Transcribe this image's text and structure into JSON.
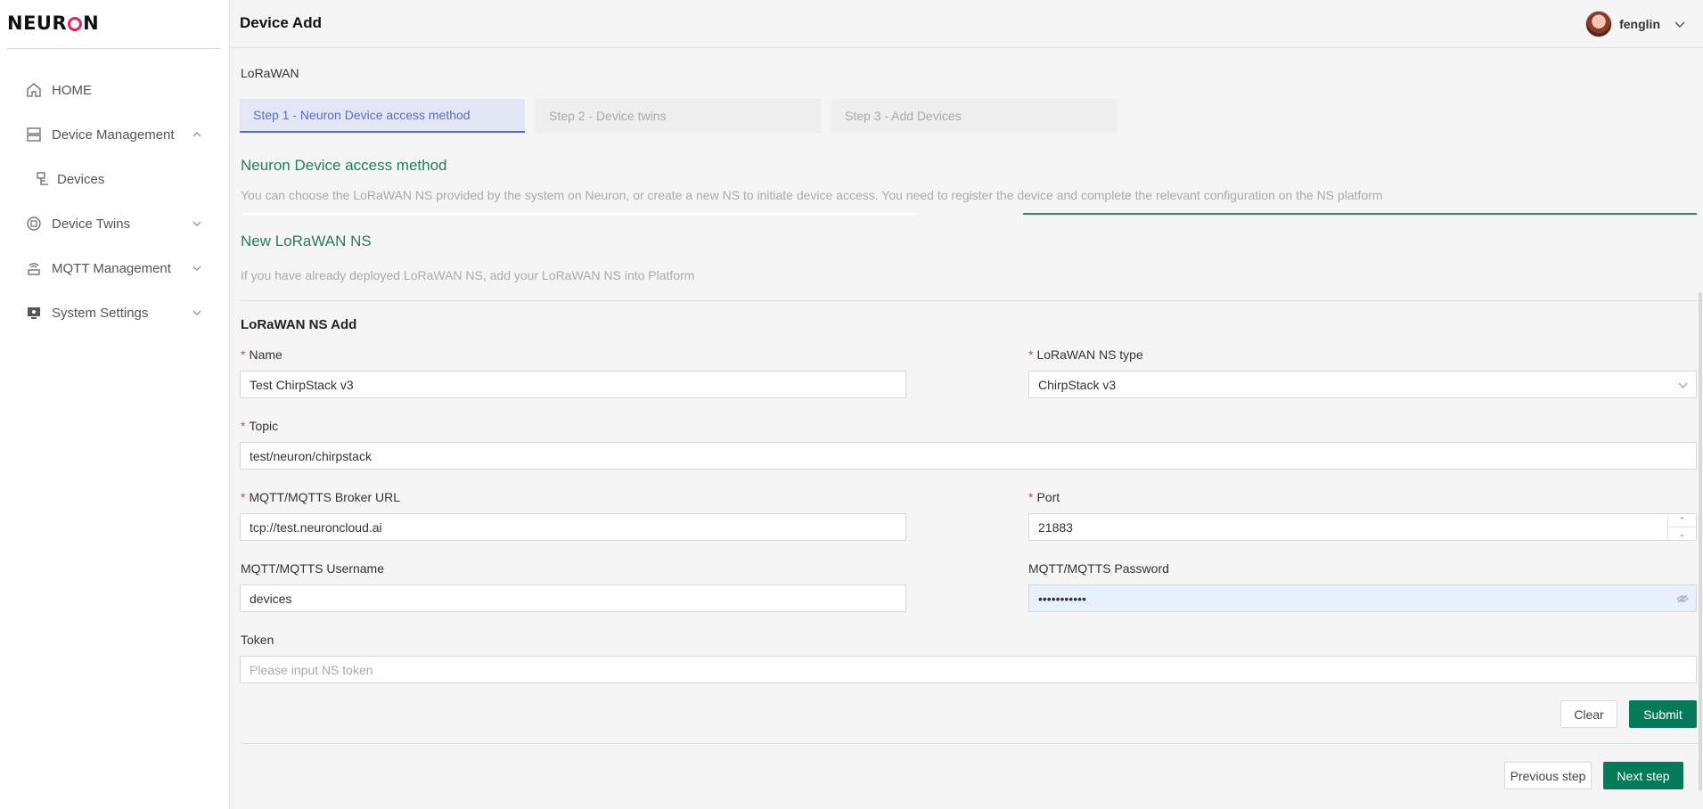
{
  "app": {
    "logo_text_left": "NEUR",
    "logo_text_right": "N"
  },
  "sidebar": {
    "items": [
      {
        "label": "HOME",
        "icon": "home-icon"
      },
      {
        "label": "Device Management",
        "icon": "server-icon",
        "chevron": "up"
      },
      {
        "label": "Devices",
        "icon": "devices-icon"
      },
      {
        "label": "Device Twins",
        "icon": "twins-icon",
        "chevron": "down"
      },
      {
        "label": "MQTT Management",
        "icon": "mqtt-icon",
        "chevron": "down"
      },
      {
        "label": "System Settings",
        "icon": "monitor-icon",
        "chevron": "down"
      }
    ]
  },
  "header": {
    "title": "Device Add",
    "user_name": "fenglin"
  },
  "main": {
    "protocol": "LoRaWAN",
    "steps": [
      {
        "label": "Step 1 - Neuron Device access method",
        "active": true
      },
      {
        "label": "Step 2 - Device twins",
        "active": false
      },
      {
        "label": "Step 3 - Add Devices",
        "active": false
      }
    ],
    "access_title": "Neuron Device access method",
    "access_desc": "You can choose the LoRaWAN NS provided by the system on Neuron, or create a new NS to initiate device access. You need to register the device and complete the relevant configuration on the NS platform",
    "new_ns_title": "New LoRaWAN NS",
    "new_ns_desc": "If you have already deployed LoRaWAN NS, add your LoRaWAN NS into Platform",
    "form": {
      "title": "LoRaWAN NS Add",
      "name_label": "Name",
      "name_value": "Test ChirpStack v3",
      "type_label": "LoRaWAN NS type",
      "type_value": "ChirpStack v3",
      "topic_label": "Topic",
      "topic_value": "test/neuron/chirpstack",
      "broker_label": "MQTT/MQTTS Broker URL",
      "broker_value": "tcp://test.neuroncloud.ai",
      "port_label": "Port",
      "port_value": "21883",
      "username_label": "MQTT/MQTTS Username",
      "username_value": "devices",
      "password_label": "MQTT/MQTTS Password",
      "password_value": "•••••••••••",
      "token_label": "Token",
      "token_placeholder": "Please input NS token",
      "clear_label": "Clear",
      "submit_label": "Submit"
    },
    "prev_label": "Previous step",
    "next_label": "Next step"
  },
  "colors": {
    "accent": "#047a5a",
    "step_active": "#5a6cc4",
    "section_title": "#2a7a5c",
    "required": "#e04040"
  }
}
